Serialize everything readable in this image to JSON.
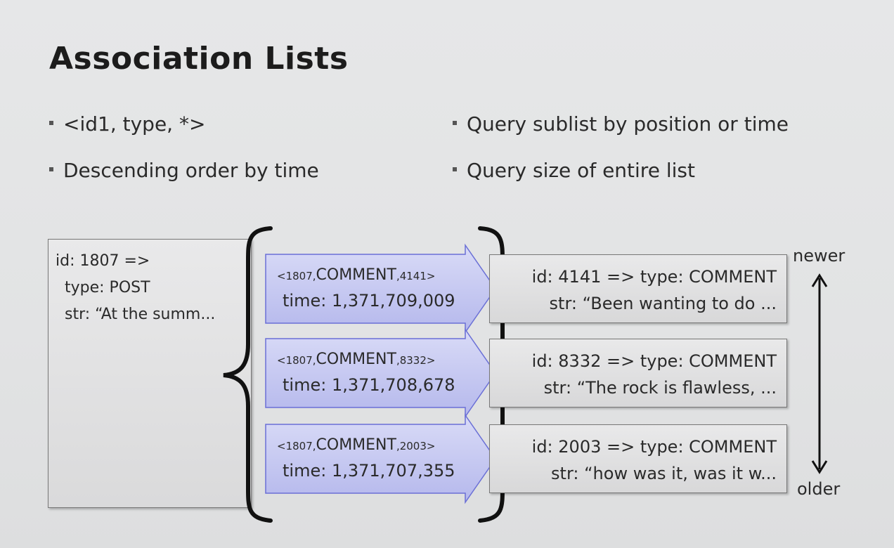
{
  "slide": {
    "title": "Association Lists",
    "bullets_left": [
      "<id1, type, *>",
      "Descending order by time"
    ],
    "bullets_right": [
      "Query sublist by position or time",
      "Query size of entire list"
    ]
  },
  "post": {
    "line1": "id: 1807 =>",
    "line2": "type: POST",
    "line3": "str: “At the summ..."
  },
  "associations": [
    {
      "key_start": "<1807,",
      "key_mid": "COMMENT",
      "key_end": ",4141>",
      "time": "time: 1,371,709,009"
    },
    {
      "key_start": "<1807,",
      "key_mid": "COMMENT",
      "key_end": ",8332>",
      "time": "time: 1,371,708,678"
    },
    {
      "key_start": "<1807,",
      "key_mid": "COMMENT",
      "key_end": ",2003>",
      "time": "time: 1,371,707,355"
    }
  ],
  "objects": [
    {
      "line1": "id: 4141 => type: COMMENT",
      "line2": "str: “Been wanting to do ..."
    },
    {
      "line1": "id: 8332 => type: COMMENT",
      "line2": "str: “The rock is flawless, ..."
    },
    {
      "line1": "id: 2003 => type: COMMENT",
      "line2": "str: “how was it, was it w..."
    }
  ],
  "order": {
    "newer": "newer",
    "older": "older"
  },
  "colors": {
    "arrow_fill_top": "#d4d6f5",
    "arrow_fill_bottom": "#b8bbee",
    "arrow_stroke": "#6a6fd6",
    "text": "#2a2a2a"
  }
}
